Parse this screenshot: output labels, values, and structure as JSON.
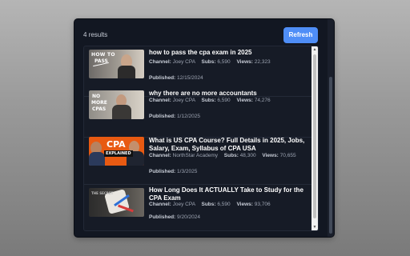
{
  "results_label": "4 results",
  "refresh_label": "Refresh",
  "labels": {
    "channel": "Channel:",
    "subs": "Subs:",
    "views": "Views:",
    "published": "Published:"
  },
  "videos": [
    {
      "title": "how to pass the cpa exam in 2025",
      "channel": "Joey CPA",
      "subs": "6,590",
      "views": "22,323",
      "published": "12/15/2024",
      "thumb_text": [
        "HOW TO",
        "PASS"
      ]
    },
    {
      "title": "why there are no more accountants",
      "channel": "Joey CPA",
      "subs": "6,590",
      "views": "74,276",
      "published": "1/12/2025",
      "thumb_text": [
        "NO",
        "MORE",
        "CPAS"
      ]
    },
    {
      "title": "What is US CPA Course? Full Details in 2025, Jobs, Salary, Exam, Syllabus of CPA USA",
      "channel": "NorthStar Academy",
      "subs": "48,300",
      "views": "70,655",
      "published": "1/3/2025",
      "thumb_text": [
        "CPA",
        "EXPLAINED"
      ]
    },
    {
      "title": "How Long Does It ACTUALLY Take to Study for the CPA Exam",
      "channel": "Joey CPA",
      "subs": "6,590",
      "views": "93,706",
      "published": "9/20/2024",
      "thumb_text": [
        "THE SECRET"
      ]
    }
  ]
}
